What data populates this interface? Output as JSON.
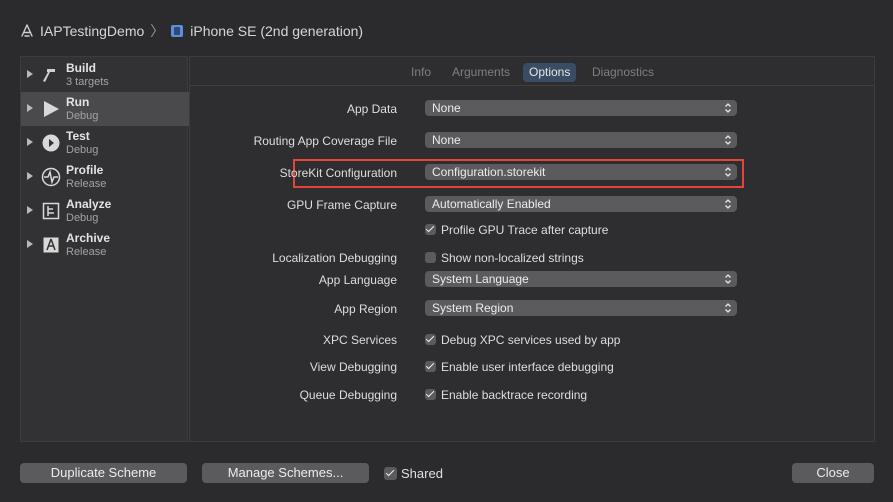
{
  "breadcrumb": {
    "project": "IAPTestingDemo",
    "device": "iPhone SE (2nd generation)"
  },
  "sidebar": {
    "items": [
      {
        "name": "Build",
        "sub": "3 targets",
        "icon": "hammer-icon"
      },
      {
        "name": "Run",
        "sub": "Debug",
        "icon": "play-icon"
      },
      {
        "name": "Test",
        "sub": "Debug",
        "icon": "test-icon"
      },
      {
        "name": "Profile",
        "sub": "Release",
        "icon": "waveform-icon"
      },
      {
        "name": "Analyze",
        "sub": "Debug",
        "icon": "analyze-icon"
      },
      {
        "name": "Archive",
        "sub": "Release",
        "icon": "archive-icon"
      }
    ],
    "selected": "Run"
  },
  "tabs": {
    "info": "Info",
    "arguments": "Arguments",
    "options": "Options",
    "diagnostics": "Diagnostics",
    "active": "Options"
  },
  "options": {
    "app_data": {
      "label": "App Data",
      "value": "None"
    },
    "routing": {
      "label": "Routing App Coverage File",
      "value": "None"
    },
    "storekit": {
      "label": "StoreKit Configuration",
      "value": "Configuration.storekit"
    },
    "gpu_frame": {
      "label": "GPU Frame Capture",
      "value": "Automatically Enabled"
    },
    "gpu_trace": {
      "label": "Profile GPU Trace after capture",
      "checked": true
    },
    "localization": {
      "label": "Localization Debugging",
      "option": "Show non-localized strings",
      "checked": false
    },
    "app_language": {
      "label": "App Language",
      "value": "System Language"
    },
    "app_region": {
      "label": "App Region",
      "value": "System Region"
    },
    "xpc": {
      "label": "XPC Services",
      "option": "Debug XPC services used by app",
      "checked": true
    },
    "view_debugging": {
      "label": "View Debugging",
      "option": "Enable user interface debugging",
      "checked": true
    },
    "queue_debugging": {
      "label": "Queue Debugging",
      "option": "Enable backtrace recording",
      "checked": true
    }
  },
  "footer": {
    "duplicate": "Duplicate Scheme",
    "manage": "Manage Schemes...",
    "shared_label": "Shared",
    "shared_checked": true,
    "close": "Close"
  },
  "colors": {
    "highlight": "#e5443b",
    "tab_active": "#3a4c63"
  }
}
